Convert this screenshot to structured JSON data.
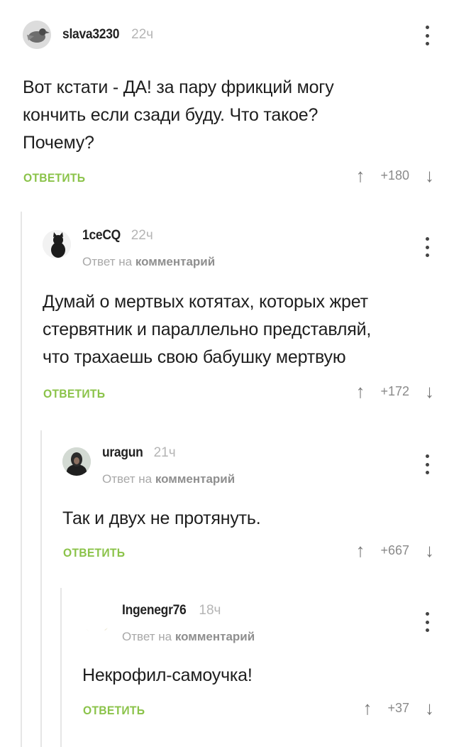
{
  "comments": [
    {
      "username": "slava3230",
      "time": "22ч",
      "reply_to": null,
      "text_lines": [
        "Вот кстати - ДА! за пару фрикций могу",
        "кончить если сзади буду. Что такое?",
        "Почему?"
      ],
      "reply_label": "ОТВЕТИТЬ",
      "score": "+180"
    },
    {
      "username": "1ceCQ",
      "time": "22ч",
      "reply_to": {
        "prefix": "Ответ на",
        "link": "комментарий"
      },
      "text_lines": [
        "Думай о мертвых котятах, которых жрет",
        "стервятник и параллельно представляй,",
        "что трахаешь свою бабушку мертвую"
      ],
      "reply_label": "ОТВЕТИТЬ",
      "score": "+172"
    },
    {
      "username": "uragun",
      "time": "21ч",
      "reply_to": {
        "prefix": "Ответ на",
        "link": "комментарий"
      },
      "text_lines": [
        "Так и двух не протянуть."
      ],
      "reply_label": "ОТВЕТИТЬ",
      "score": "+667"
    },
    {
      "username": "Ingenegr76",
      "time": "18ч",
      "reply_to": {
        "prefix": "Ответ на",
        "link": "комментарий"
      },
      "text_lines": [
        "Некрофил-самоучка!"
      ],
      "reply_label": "ОТВЕТИТЬ",
      "score": "+37"
    }
  ],
  "icons": {
    "upvote": "arrow-up-icon",
    "downvote": "arrow-down-icon",
    "menu": "more-vertical-icon"
  },
  "colors": {
    "accent": "#8bc34a",
    "thread_line": "#e6e6e6"
  }
}
